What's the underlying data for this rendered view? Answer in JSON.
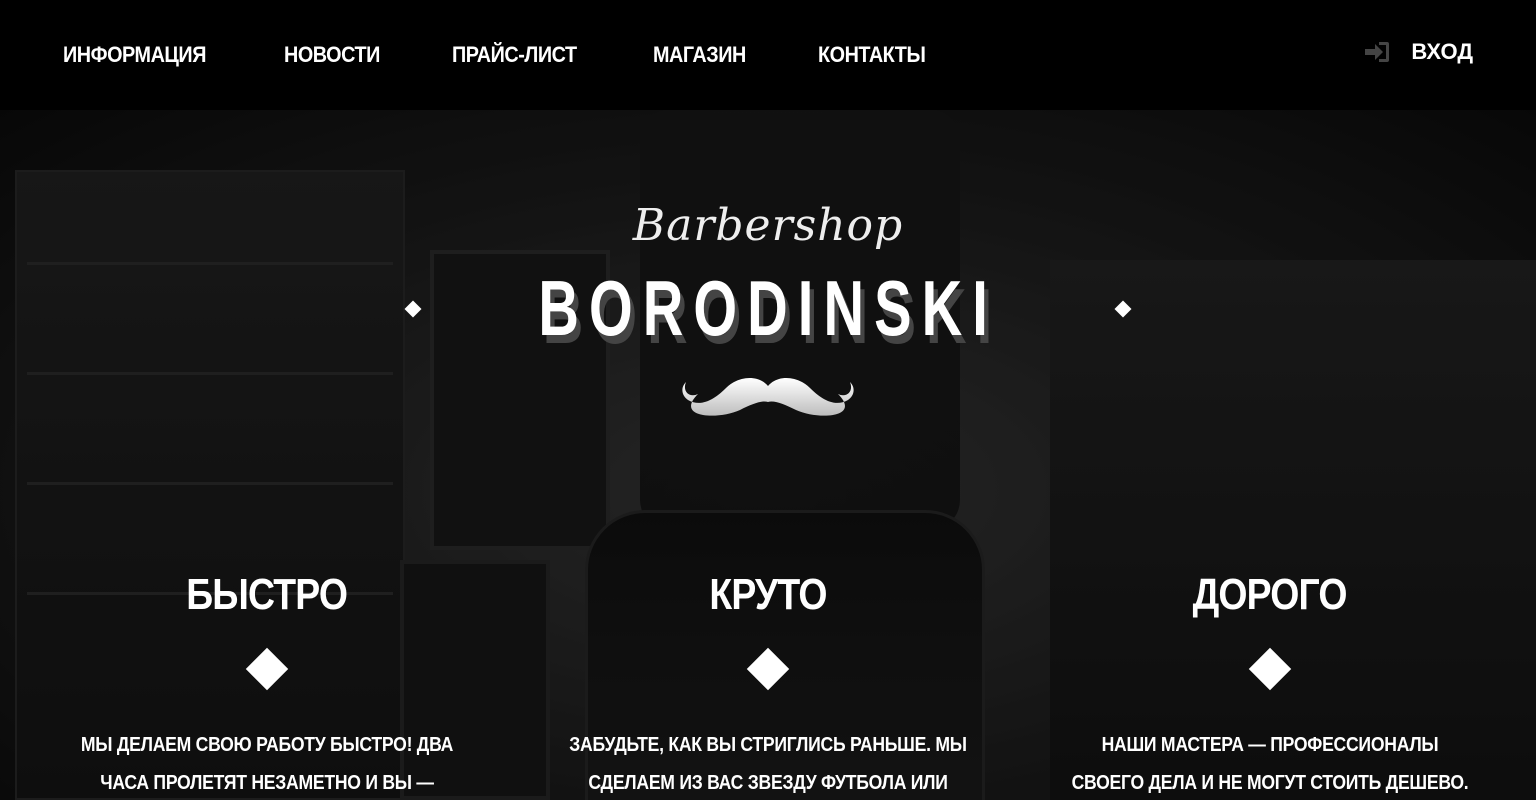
{
  "nav": {
    "items": [
      {
        "label": "ИНФОРМАЦИЯ"
      },
      {
        "label": "НОВОСТИ"
      },
      {
        "label": "ПРАЙС-ЛИСТ"
      },
      {
        "label": "МАГАЗИН"
      },
      {
        "label": "КОНТАКТЫ"
      }
    ],
    "login_label": "ВХОД",
    "login_icon": "sign-in-icon"
  },
  "hero": {
    "script_title": "Barbershop",
    "brand": "BORODINSKI",
    "emblem_icon": "mustache-icon"
  },
  "features": [
    {
      "title": "БЫСТРО",
      "text": "МЫ ДЕЛАЕМ СВОЮ РАБОТУ БЫСТРО! ДВА ЧАСА ПРОЛЕТЯТ НЕЗАМЕТНО И ВЫ — СЧАСТЛИВЫЙ"
    },
    {
      "title": "КРУТО",
      "text": "ЗАБУДЬТЕ, КАК ВЫ СТРИГЛИСЬ РАНЬШЕ. МЫ СДЕЛАЕМ ИЗ ВАС ЗВЕЗДУ ФУТБОЛА ИЛИ КИНО! ВО"
    },
    {
      "title": "ДОРОГО",
      "text": "НАШИ МАСТЕРА — ПРОФЕССИОНАЛЫ СВОЕГО ДЕЛА И НЕ МОГУТ СТОИТЬ ДЕШЕВО. К ТОМУ ЖЕ, РАЗВЕ ЦЕНА"
    }
  ],
  "colors": {
    "header_bg": "#000000",
    "text": "#ffffff"
  }
}
